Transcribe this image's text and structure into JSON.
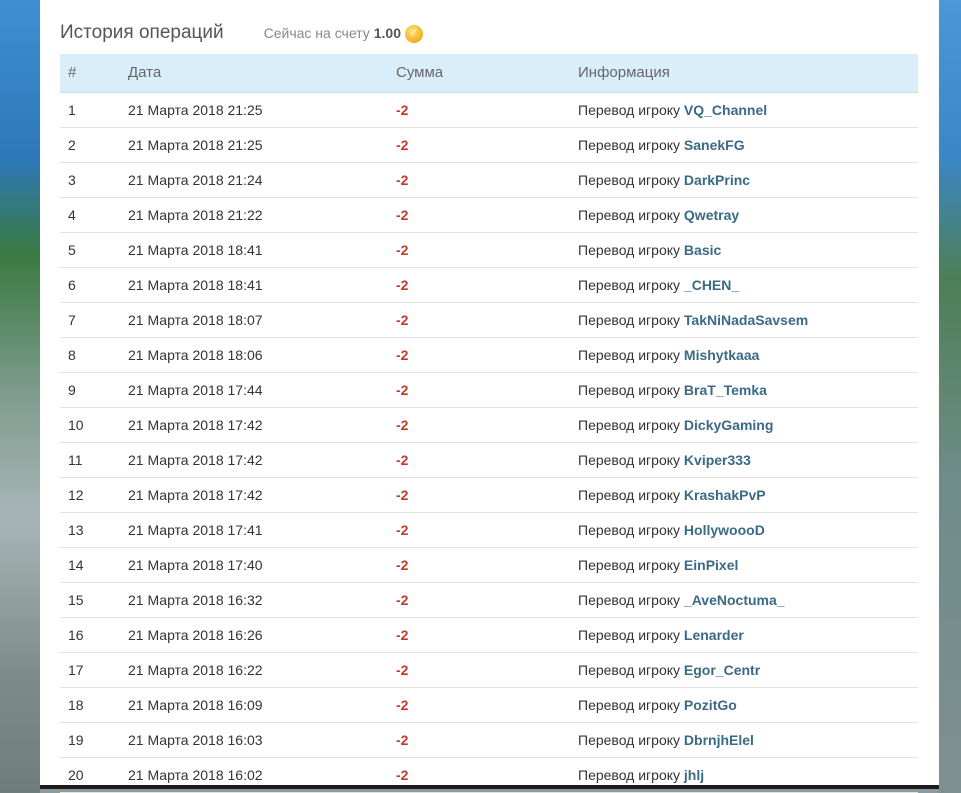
{
  "header": {
    "title": "История операций",
    "balance_label": "Сейчас на счету",
    "balance_value": "1.00",
    "balance_icon": "coin-icon"
  },
  "table": {
    "columns": [
      "#",
      "Дата",
      "Сумма",
      "Информация"
    ],
    "info_prefix": "Перевод игроку",
    "rows": [
      {
        "num": "1",
        "date": "21 Марта 2018 21:25",
        "amount": "-2",
        "player": "VQ_Channel"
      },
      {
        "num": "2",
        "date": "21 Марта 2018 21:25",
        "amount": "-2",
        "player": "SanekFG"
      },
      {
        "num": "3",
        "date": "21 Марта 2018 21:24",
        "amount": "-2",
        "player": "DarkPrinc"
      },
      {
        "num": "4",
        "date": "21 Марта 2018 21:22",
        "amount": "-2",
        "player": "Qwetray"
      },
      {
        "num": "5",
        "date": "21 Марта 2018 18:41",
        "amount": "-2",
        "player": "Basic"
      },
      {
        "num": "6",
        "date": "21 Марта 2018 18:41",
        "amount": "-2",
        "player": "_CHEN_"
      },
      {
        "num": "7",
        "date": "21 Марта 2018 18:07",
        "amount": "-2",
        "player": "TakNiNadaSavsem"
      },
      {
        "num": "8",
        "date": "21 Марта 2018 18:06",
        "amount": "-2",
        "player": "Mishytkaaa"
      },
      {
        "num": "9",
        "date": "21 Марта 2018 17:44",
        "amount": "-2",
        "player": "BraT_Temka"
      },
      {
        "num": "10",
        "date": "21 Марта 2018 17:42",
        "amount": "-2",
        "player": "DickyGaming"
      },
      {
        "num": "11",
        "date": "21 Марта 2018 17:42",
        "amount": "-2",
        "player": "Kviper333"
      },
      {
        "num": "12",
        "date": "21 Марта 2018 17:42",
        "amount": "-2",
        "player": "KrashakPvP"
      },
      {
        "num": "13",
        "date": "21 Марта 2018 17:41",
        "amount": "-2",
        "player": "HollywoooD"
      },
      {
        "num": "14",
        "date": "21 Марта 2018 17:40",
        "amount": "-2",
        "player": "EinPixel"
      },
      {
        "num": "15",
        "date": "21 Марта 2018 16:32",
        "amount": "-2",
        "player": "_AveNoctuma_"
      },
      {
        "num": "16",
        "date": "21 Марта 2018 16:26",
        "amount": "-2",
        "player": "Lenarder"
      },
      {
        "num": "17",
        "date": "21 Марта 2018 16:22",
        "amount": "-2",
        "player": "Egor_Centr"
      },
      {
        "num": "18",
        "date": "21 Марта 2018 16:09",
        "amount": "-2",
        "player": "PozitGo"
      },
      {
        "num": "19",
        "date": "21 Марта 2018 16:03",
        "amount": "-2",
        "player": "DbrnjhElel"
      },
      {
        "num": "20",
        "date": "21 Марта 2018 16:02",
        "amount": "-2",
        "player": "jhlj"
      }
    ]
  },
  "colors": {
    "header_bg": "#daeef9",
    "amount": "#c0392b",
    "player_link": "#3a6a86"
  }
}
